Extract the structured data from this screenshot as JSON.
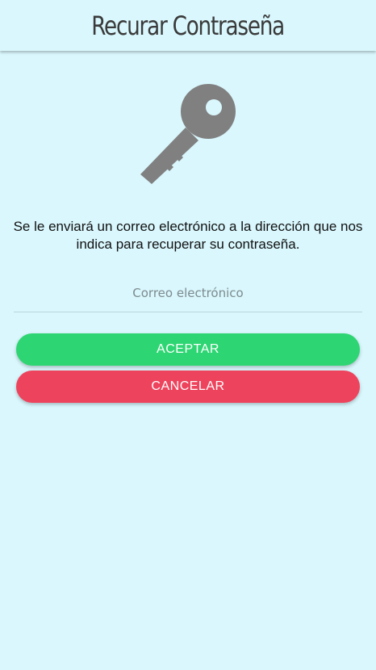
{
  "header": {
    "title": "Recurar Contraseña"
  },
  "icons": {
    "key": "key-icon",
    "key_color": "#808080"
  },
  "main": {
    "description": "Se le enviará un correo electrónico a la dirección que nos indica para recuperar su contraseña.",
    "email": {
      "placeholder": "Correo electrónico",
      "value": ""
    }
  },
  "actions": {
    "accept_label": "ACEPTAR",
    "cancel_label": "CANCELAR",
    "accept_color": "#2dd672",
    "cancel_color": "#ee435c"
  }
}
